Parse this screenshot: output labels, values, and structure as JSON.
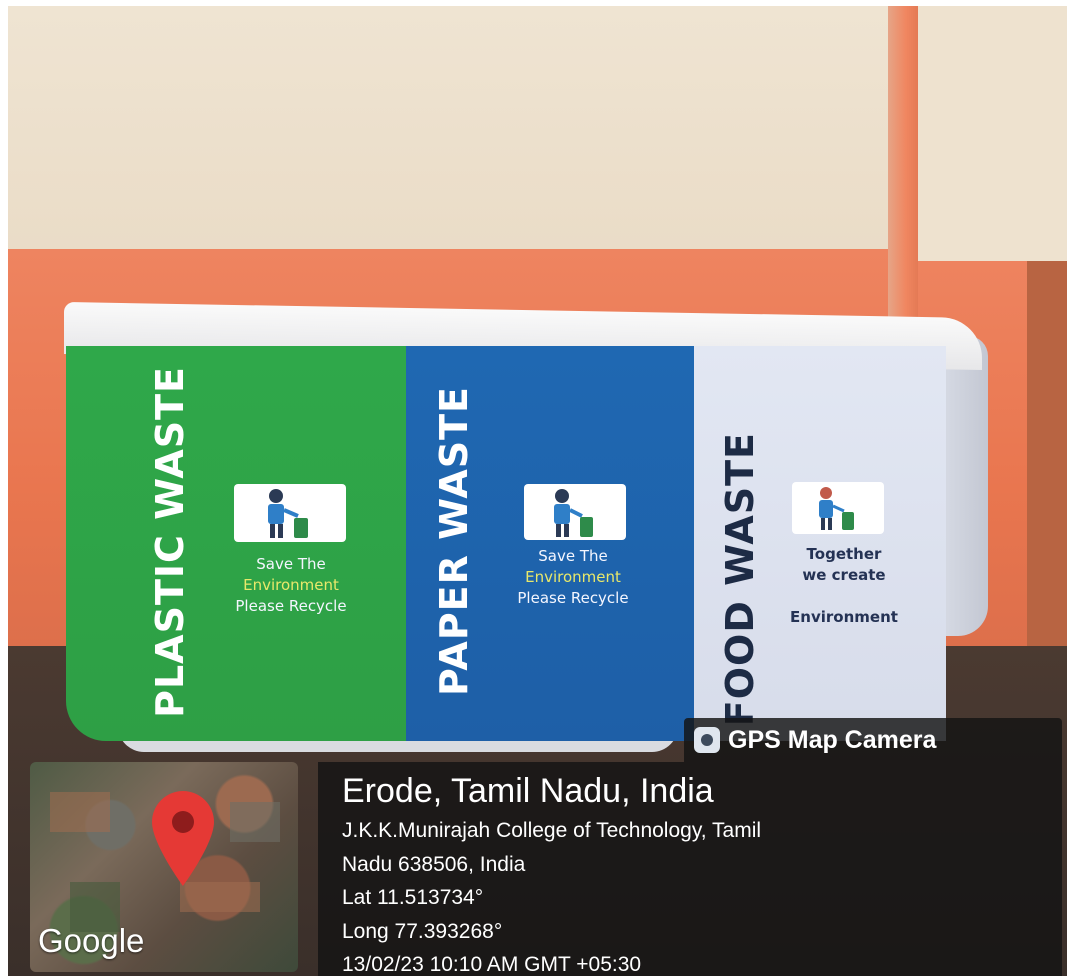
{
  "bin": {
    "panels": [
      {
        "label": "PLASTIC WASTE",
        "slogan": [
          "Save The",
          "Environment",
          "Please Recycle"
        ],
        "color": "#2fa84a"
      },
      {
        "label": "PAPER WASTE",
        "slogan": [
          "Save The",
          "Environment",
          "Please Recycle"
        ],
        "color": "#1f68b2"
      },
      {
        "label": "FOOD WASTE",
        "slogan": [
          "Together",
          "we create",
          "Environment"
        ],
        "color": "#e2e7f3"
      }
    ]
  },
  "overlay": {
    "badge": "GPS Map Camera",
    "map_brand": "Google",
    "location_title": "Erode, Tamil Nadu, India",
    "address_line1": "J.K.K.Munirajah College of Technology, Tamil",
    "address_line2": "Nadu 638506, India",
    "lat": "Lat 11.513734°",
    "long": "Long 77.393268°",
    "timestamp": "13/02/23 10:10 AM GMT +05:30",
    "pin_color": "#e53935"
  }
}
